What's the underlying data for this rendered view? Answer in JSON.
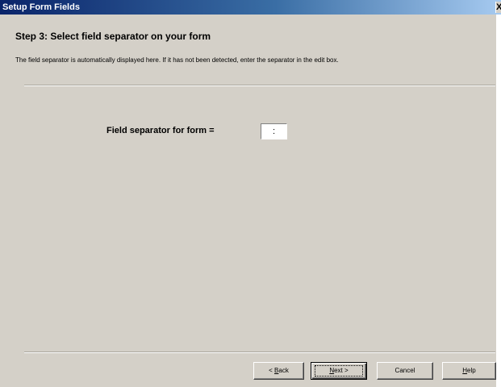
{
  "window": {
    "title": "Setup Form Fields",
    "close_glyph": "X"
  },
  "step": {
    "title": "Step 3:  Select field separator on your form",
    "description": "The field separator is automatically displayed here. If it has not been detected, enter the separator in the edit box."
  },
  "form": {
    "separator_label": "Field separator for form =",
    "separator_value": ":"
  },
  "buttons": {
    "back": {
      "prefix": "< ",
      "mnemonic": "B",
      "rest": "ack"
    },
    "next": {
      "prefix": "",
      "mnemonic": "N",
      "rest": "ext >"
    },
    "cancel": {
      "label": "Cancel"
    },
    "help": {
      "prefix": "",
      "mnemonic": "H",
      "rest": "elp"
    }
  },
  "colors": {
    "title_bar_start": "#0a246a",
    "title_bar_end": "#a6caf0",
    "dialog_face": "#d4d0c8"
  },
  "icons": {
    "close": "close-icon"
  }
}
